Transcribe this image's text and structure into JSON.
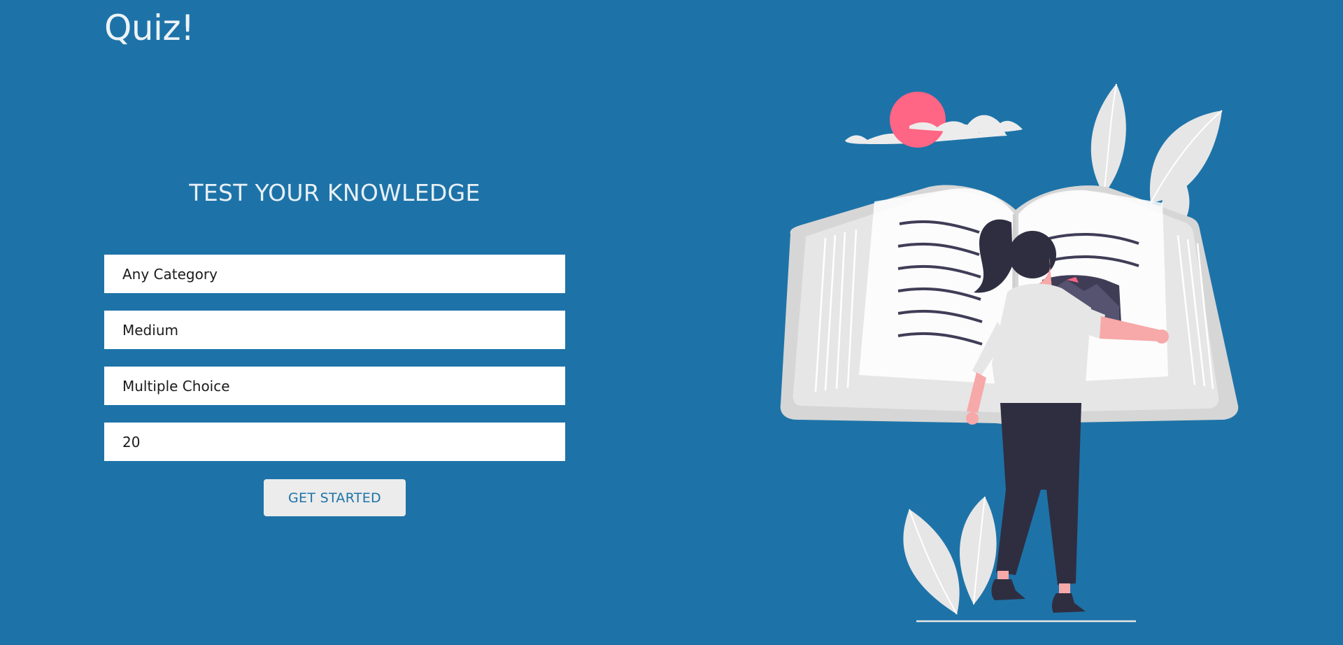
{
  "header": {
    "logo": "Quiz!"
  },
  "main": {
    "headline": "TEST YOUR KNOWLEDGE",
    "fields": {
      "category": "Any Category",
      "difficulty": "Medium",
      "type": "Multiple Choice",
      "amount": "20"
    },
    "start_label": "GET STARTED"
  },
  "colors": {
    "background": "#1d73a8",
    "button_bg": "#ececec",
    "button_text": "#1d73a8",
    "sun": "#ff6584",
    "figure_dark": "#2f2e41",
    "skin": "#f7a8a8"
  },
  "illustration": {
    "name": "woman-reading-giant-book"
  }
}
